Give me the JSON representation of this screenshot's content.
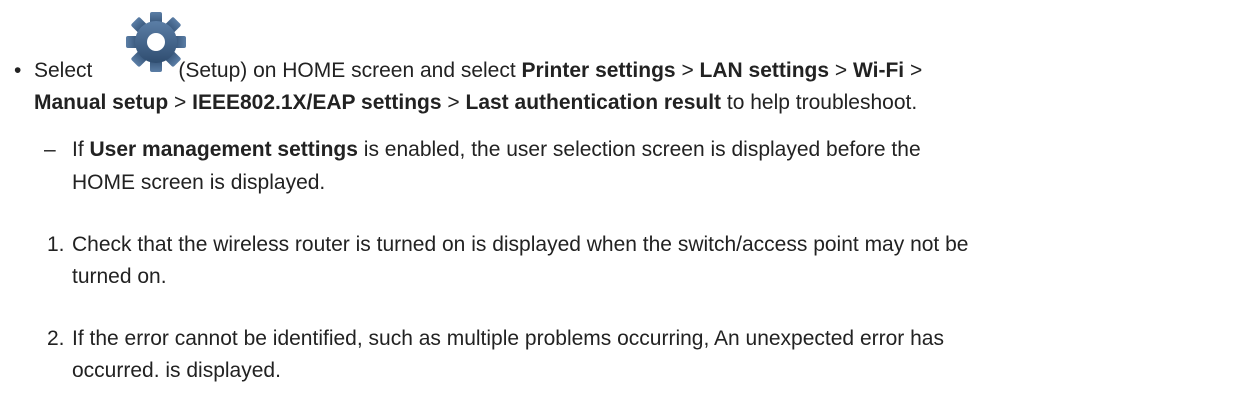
{
  "bullet": {
    "marker": "•",
    "select_word": "Select",
    "icon": "gear-icon",
    "icon_color": "#3e5f84",
    "setup_text": "(Setup) on HOME screen and select",
    "printer_settings": "Printer settings",
    "sep1": ">",
    "lan_settings": "LAN settings",
    "sep2": ">",
    "wifi": "Wi-Fi",
    "sep3": ">",
    "manual_setup": "Manual setup",
    "sep4": ">",
    "eap_settings": "IEEE802.1X/EAP settings",
    "sep5": ">",
    "last_auth": "Last authentication result",
    "tail": "to help troubleshoot."
  },
  "note": {
    "marker": "–",
    "prefix": "If",
    "bold_term": "User management settings",
    "line1_rest": "is enabled, the user selection screen is displayed before the",
    "line2": "HOME screen is displayed."
  },
  "steps": [
    {
      "number": "1.",
      "line1": "Check that the wireless router is turned on is displayed when the switch/access point may not be",
      "line2": "turned on."
    },
    {
      "number": "2.",
      "line1": "If the error cannot be identified, such as multiple problems occurring, An unexpected error has",
      "line2": "occurred. is displayed."
    }
  ]
}
